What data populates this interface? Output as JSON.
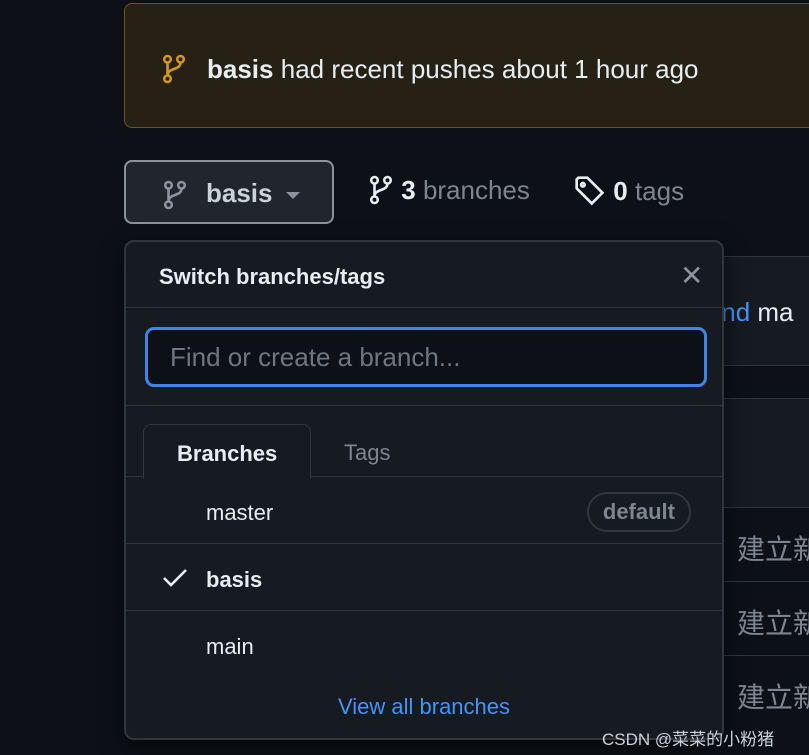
{
  "banner": {
    "icon": "git-branch-icon",
    "branch": "basis",
    "message": "had recent pushes about 1 hour ago",
    "color": "#d29922"
  },
  "branch_selector": {
    "icon": "git-branch-icon",
    "label": "basis"
  },
  "branches_count": {
    "count": "3",
    "label": "branches"
  },
  "tags_count": {
    "count": "0",
    "label": "tags"
  },
  "background": {
    "partial_link": "hind",
    "partial_text": "ma",
    "commit_rows": [
      "建立新",
      "建立新",
      "建立新"
    ]
  },
  "dropdown": {
    "title": "Switch branches/tags",
    "search_placeholder": "Find or create a branch...",
    "tabs": [
      {
        "label": "Branches",
        "active": true
      },
      {
        "label": "Tags",
        "active": false
      }
    ],
    "branches": [
      {
        "name": "master",
        "badge": "default",
        "selected": false
      },
      {
        "name": "basis",
        "selected": true
      },
      {
        "name": "main",
        "selected": false
      }
    ],
    "view_all": "View all branches",
    "accent": "#4184e4"
  },
  "watermark": "CSDN @菜菜的小粉猪"
}
